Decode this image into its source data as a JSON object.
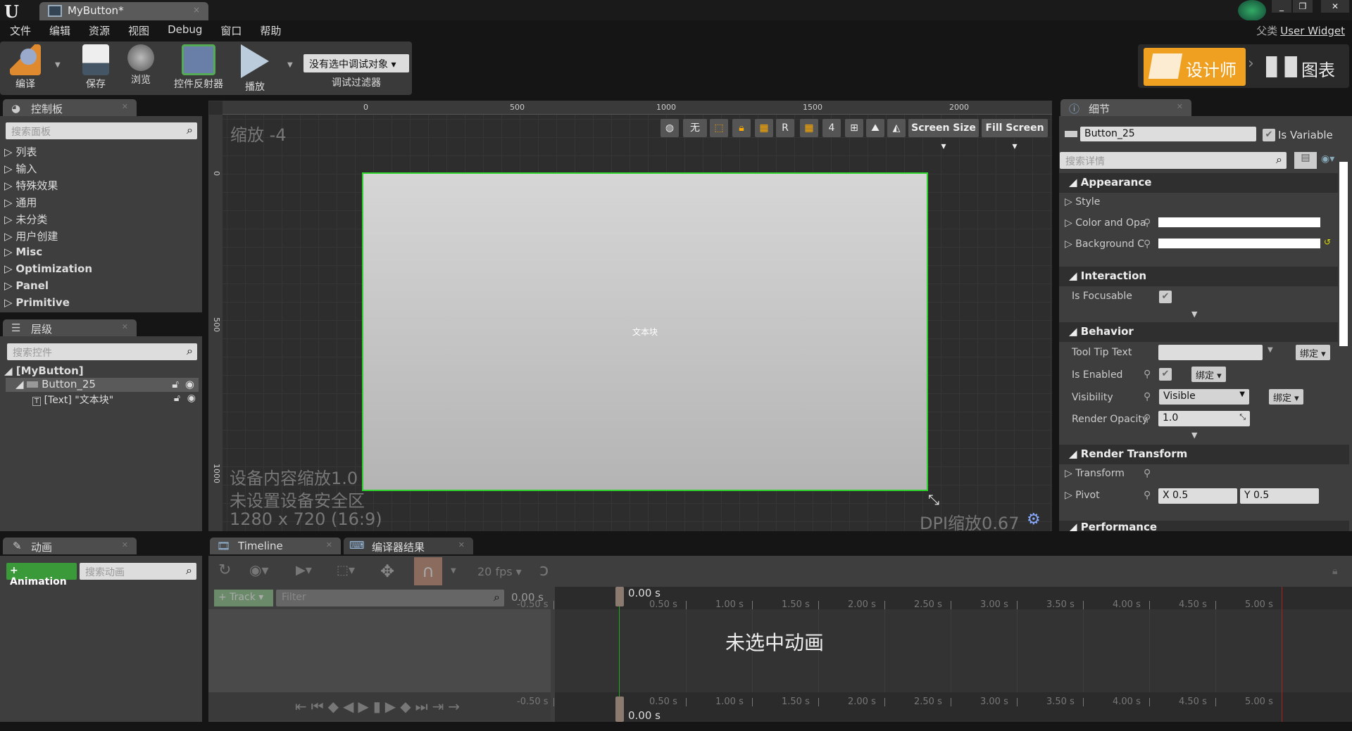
{
  "titlebar": {
    "logo": "U",
    "tab": "MyButton*",
    "close": "×",
    "min": "_",
    "max": "❐",
    "winclose": "✕"
  },
  "menu": [
    "文件",
    "编辑",
    "资源",
    "视图",
    "Debug",
    "窗口",
    "帮助"
  ],
  "parent_class": {
    "label": "父类",
    "value": "User Widget"
  },
  "toolbar": {
    "compile": "编译",
    "save": "保存",
    "browse": "浏览",
    "reflector": "控件反射器",
    "play": "播放",
    "debug_object": "没有选中调试对象 ▾",
    "debug_filter": "调试过滤器"
  },
  "modes": {
    "designer": "设计师",
    "graph": "图表"
  },
  "palette": {
    "title": "控制板",
    "search_placeholder": "搜索面板",
    "categories": [
      "列表",
      "输入",
      "特殊效果",
      "通用",
      "未分类",
      "用户创建",
      "Misc",
      "Optimization",
      "Panel",
      "Primitive"
    ]
  },
  "hierarchy": {
    "title": "层级",
    "search_placeholder": "搜索控件",
    "root": "[MyButton]",
    "button": "Button_25",
    "text": "[Text] \"文本块\""
  },
  "canvas": {
    "zoom": "缩放 -4",
    "ruler_x": [
      "0",
      "500",
      "1000",
      "1500",
      "2000"
    ],
    "ruler_y": [
      "0",
      "500",
      "1000"
    ],
    "tools": [
      "无",
      "R",
      "4"
    ],
    "screen_size": "Screen Size ▾",
    "fill_screen": "Fill Screen ▾",
    "widget_text": "文本块",
    "device_scale": "设备内容缩放1.0",
    "safe_zone": "未设置设备安全区",
    "resolution": "1280 x 720 (16:9)",
    "dpi": "DPI缩放0.67",
    "accent": "#2dd22d"
  },
  "details": {
    "title": "细节",
    "name": "Button_25",
    "is_variable": "Is Variable",
    "search_placeholder": "搜索详情",
    "sections": {
      "appearance": "Appearance",
      "interaction": "Interaction",
      "behavior": "Behavior",
      "render_transform": "Render Transform",
      "performance": "Performance"
    },
    "style": "Style",
    "color_opacity": "Color and Opa",
    "background": "Background C​",
    "is_focusable": "Is Focusable",
    "tooltip": "Tool Tip Text",
    "is_enabled": "Is Enabled",
    "visibility": "Visibility",
    "visibility_value": "Visible",
    "render_opacity": "Render Opacity",
    "render_opacity_value": "1.0",
    "bind": "绑定 ▾",
    "transform": "Transform",
    "pivot": "Pivot",
    "pivot_x": "X  0.5",
    "pivot_y": "Y  0.5"
  },
  "animations": {
    "title": "动画",
    "add": "+ Animation",
    "search_placeholder": "搜索动画"
  },
  "timeline": {
    "tab": "Timeline",
    "compiler_tab": "编译器结果",
    "fps": "20 fps ▾",
    "track": "+ Track ▾",
    "filter_placeholder": "Filter",
    "time": "0.00 s",
    "playhead": "0.00 s",
    "empty": "未选中动画",
    "ticks": [
      "-0.50 s",
      "0.50 s",
      "1.00 s",
      "1.50 s",
      "2.00 s",
      "2.50 s",
      "3.00 s",
      "3.50 s",
      "4.00 s",
      "4.50 s",
      "5.00 s"
    ]
  }
}
